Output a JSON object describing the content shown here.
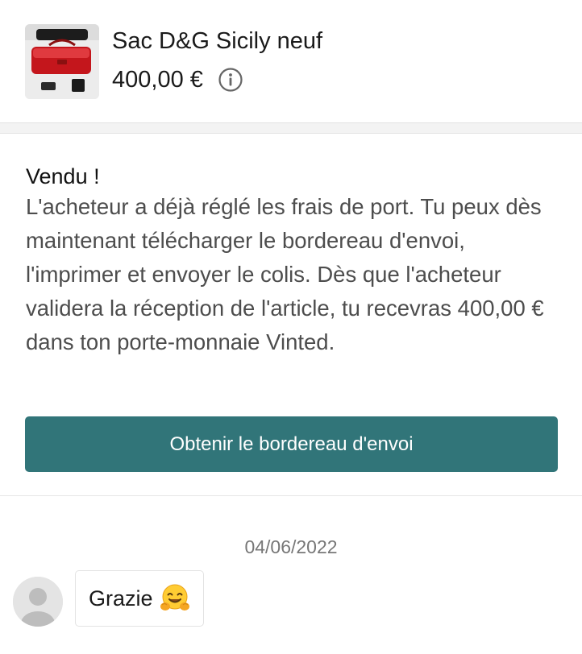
{
  "item": {
    "title": "Sac D&G Sicily neuf",
    "price": "400,00 €",
    "thumbnail_icon": "red-handbag-photo",
    "info_icon": "info-icon"
  },
  "sold_notice": {
    "title": "Vendu !",
    "body": "L'acheteur a déjà réglé les frais de port. Tu peux dès maintenant télécharger le bordereau d'envoi, l'imprimer et envoyer le colis. Dès que l'acheteur validera la réception de l'article, tu recevras 400,00 € dans ton porte-monnaie Vinted.",
    "button_label": "Obtenir le bordereau d'envoi"
  },
  "conversation": {
    "date": "04/06/2022",
    "messages": [
      {
        "text": "Grazie",
        "emoji": "hugging-face-emoji",
        "avatar_icon": "default-user-avatar"
      }
    ]
  },
  "colors": {
    "accent": "#317579",
    "body_text": "#4d4d4d",
    "muted_text": "#777777",
    "divider": "#f3f3f3"
  }
}
